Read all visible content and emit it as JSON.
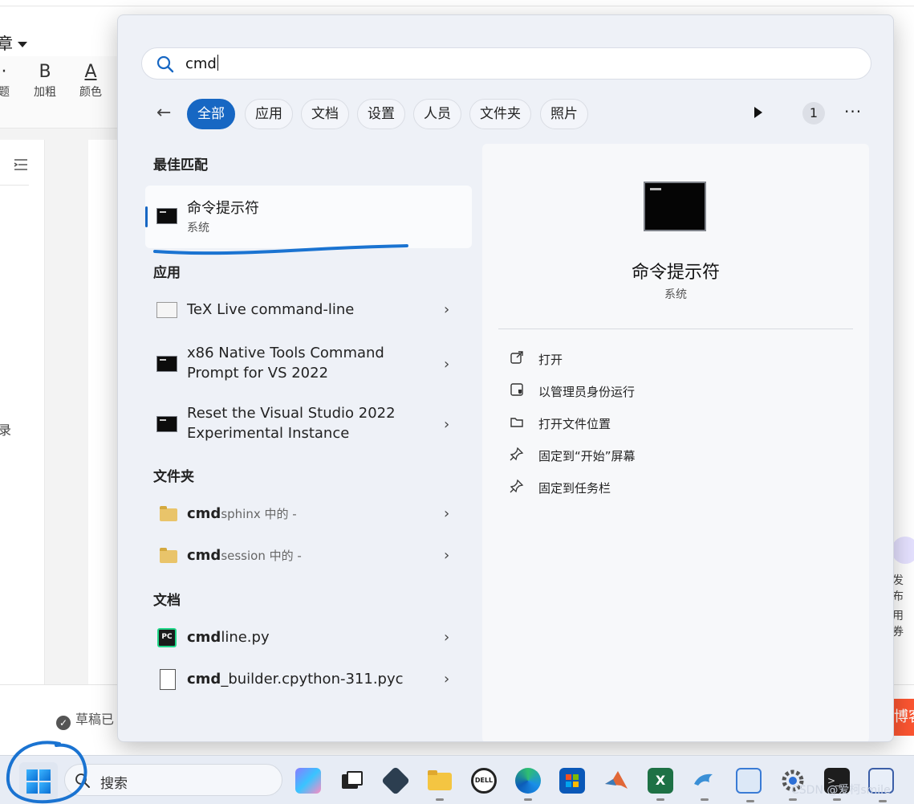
{
  "background": {
    "doc_title": "章",
    "toolbar": [
      {
        "glyph": "·",
        "label": "题"
      },
      {
        "glyph": "B",
        "label": "加粗"
      },
      {
        "glyph": "A",
        "label": "颜色"
      }
    ],
    "left_label": "录",
    "draft_status": "草稿已",
    "publish_label": "博客",
    "right_labels": [
      "发布",
      "用券"
    ]
  },
  "start_menu": {
    "search": {
      "value": "cmd",
      "placeholder": ""
    },
    "filters": [
      "全部",
      "应用",
      "文档",
      "设置",
      "人员",
      "文件夹",
      "照片"
    ],
    "active_filter": "全部",
    "badge_count": "1",
    "sections": {
      "best_match": "最佳匹配",
      "apps": "应用",
      "folders": "文件夹",
      "documents": "文档"
    },
    "best_match": {
      "name": "命令提示符",
      "sub": "系统"
    },
    "apps": [
      {
        "line1": "TeX Live command-line",
        "line2": ""
      },
      {
        "line1": "x86 Native Tools Command",
        "line2": "Prompt for VS 2022"
      },
      {
        "line1": "Reset the Visual Studio 2022",
        "line2": "Experimental Instance"
      }
    ],
    "folders": [
      {
        "bold": "cmd",
        "rest": "sphinx",
        "suffix": " 中的 -"
      },
      {
        "bold": "cmd",
        "rest": "session",
        "suffix": " 中的 -"
      }
    ],
    "documents": [
      {
        "bold": "cmd",
        "rest": "line.py"
      },
      {
        "bold": "cmd",
        "rest": "_builder.cpython-311.pyc"
      }
    ],
    "detail": {
      "title": "命令提示符",
      "sub": "系统",
      "actions": [
        "打开",
        "以管理员身份运行",
        "打开文件位置",
        "固定到“开始”屏幕",
        "固定到任务栏"
      ]
    }
  },
  "taskbar": {
    "search_placeholder": "搜索",
    "pycharm_label": "PC",
    "dell_label": "DELL",
    "watermark": "CSDN @爱柯smile"
  },
  "colors": {
    "accent": "#1767c3",
    "annotation_blue": "#1a73d1",
    "publish": "#fc5531"
  }
}
